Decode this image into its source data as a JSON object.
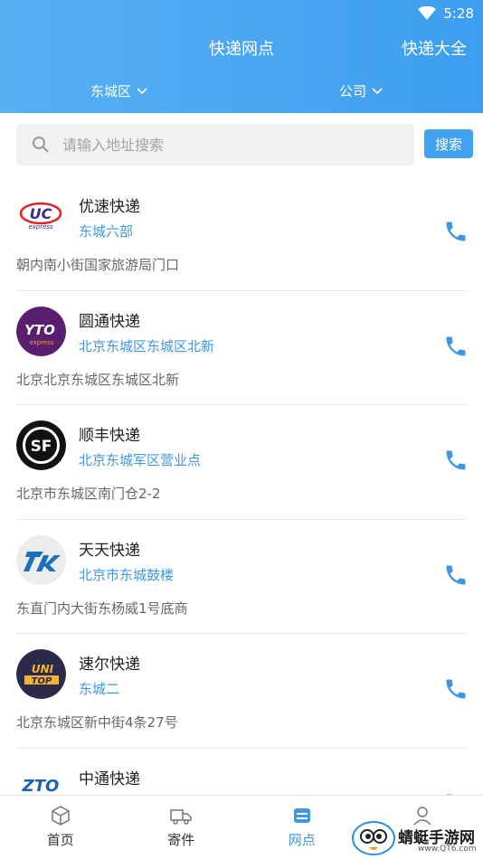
{
  "status": {
    "time": "5:28"
  },
  "header": {
    "title": "快递网点",
    "express_all": "快递大全"
  },
  "filters": {
    "district": "东城区",
    "company": "公司"
  },
  "search": {
    "placeholder": "请输入地址搜索",
    "button": "搜索"
  },
  "outlets": [
    {
      "name": "优速快递",
      "branch": "东城六部",
      "address": "朝内南小街国家旅游局门口",
      "logo": "uc-express-logo"
    },
    {
      "name": "圆通快递",
      "branch": "北京东城区东城区北新",
      "address": "北京北京东城区东城区北新",
      "logo": "yto-express-logo"
    },
    {
      "name": "顺丰快递",
      "branch": "北京东城军区营业点",
      "address": "北京市东城区南门仓2-2",
      "logo": "sf-express-logo"
    },
    {
      "name": "天天快递",
      "branch": "北京市东城鼓楼",
      "address": "东直门内大街东杨威1号底商",
      "logo": "tiantian-express-logo"
    },
    {
      "name": "速尔快递",
      "branch": "东城二",
      "address": "北京东城区新中街4条27号",
      "logo": "unitop-express-logo"
    },
    {
      "name": "中通快递",
      "branch": "",
      "address": "",
      "logo": "zto-express-logo"
    }
  ],
  "logo_text": {
    "uc": "UC",
    "uc_sub": "express",
    "yto": "YTO",
    "yto_sub": "express",
    "sf": "SF",
    "unitop_1": "UNI",
    "unitop_2": "TOP",
    "zto": "ZTO"
  },
  "tabs": [
    {
      "label": "首页",
      "icon": "cube-icon"
    },
    {
      "label": "寄件",
      "icon": "truck-icon"
    },
    {
      "label": "网点",
      "icon": "outlet-icon"
    },
    {
      "label": "",
      "icon": "user-icon"
    }
  ],
  "active_tab": 2,
  "watermark": {
    "text": "蜻蜓手游网",
    "url": "www.QT6.com"
  },
  "colors": {
    "accent": "#3f97e4",
    "header": "#4aa8f2"
  }
}
